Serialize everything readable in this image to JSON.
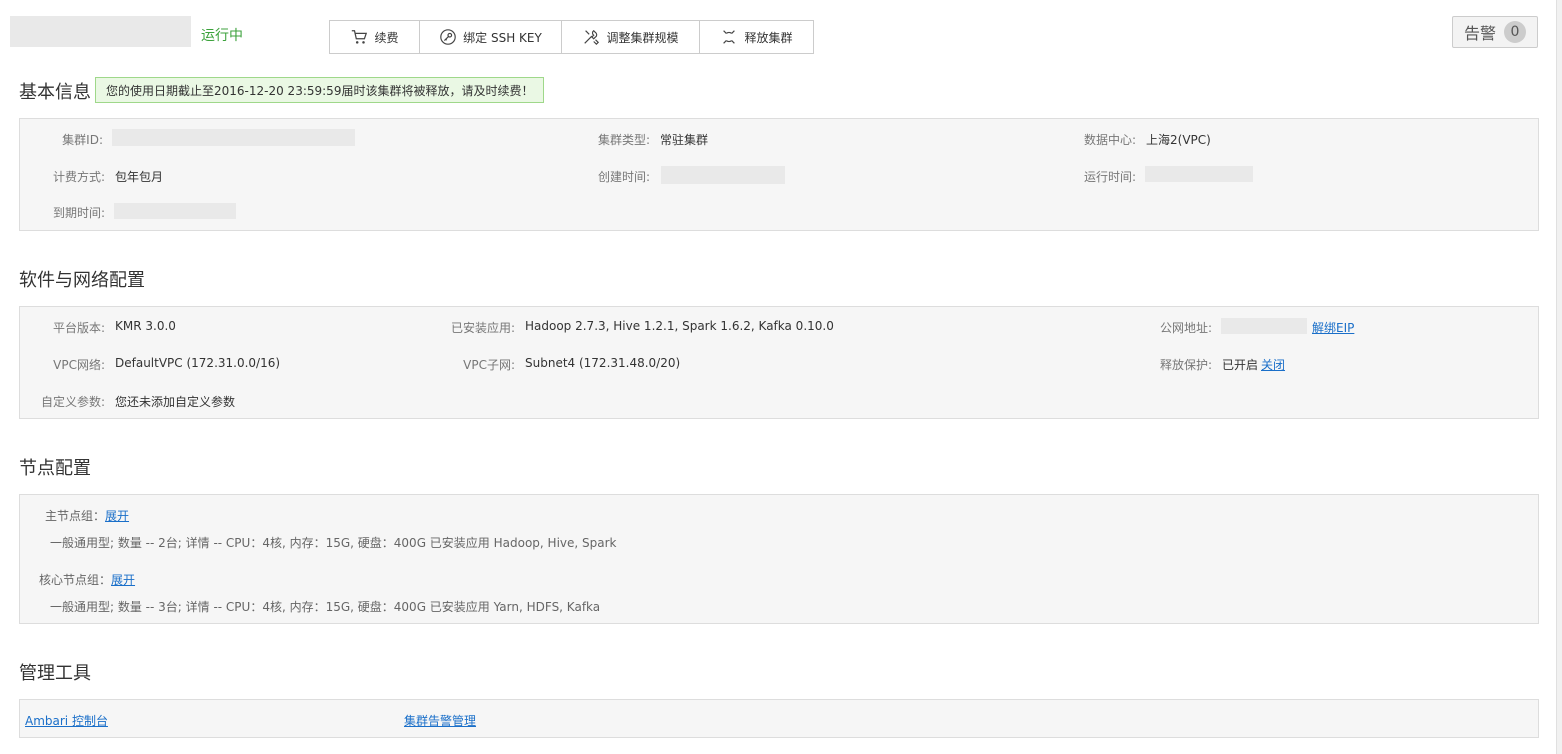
{
  "header": {
    "status": "运行中",
    "toolbar": [
      {
        "label": "续费",
        "icon": "cart-icon"
      },
      {
        "label": "绑定 SSH KEY",
        "icon": "key-icon"
      },
      {
        "label": "调整集群规模",
        "icon": "tools-icon"
      },
      {
        "label": "释放集群",
        "icon": "release-icon"
      }
    ],
    "alarm": {
      "label": "告警",
      "count": "0"
    }
  },
  "basic": {
    "title": "基本信息",
    "notice": "您的使用日期截止至2016-12-20 23:59:59届时该集群将被释放，请及时续费！",
    "cluster_id_label": "集群ID:",
    "cluster_type_label": "集群类型:",
    "cluster_type": "常驻集群",
    "datacenter_label": "数据中心:",
    "datacenter": "上海2(VPC)",
    "billing_label": "计费方式:",
    "billing": "包年包月",
    "created_label": "创建时间:",
    "runtime_label": "运行时间:",
    "expire_label": "到期时间:"
  },
  "software": {
    "title": "软件与网络配置",
    "platform_label": "平台版本:",
    "platform": "KMR 3.0.0",
    "apps_label": "已安装应用:",
    "apps": "Hadoop 2.7.3, Hive 1.2.1, Spark 1.6.2, Kafka 0.10.0",
    "public_ip_label": "公网地址:",
    "unbind_eip": "解绑EIP",
    "vpc_label": "VPC网络:",
    "vpc": "DefaultVPC (172.31.0.0/16)",
    "subnet_label": "VPC子网:",
    "subnet": "Subnet4 (172.31.48.0/20)",
    "protect_label": "释放保护:",
    "protect": "已开启",
    "protect_close": "关闭",
    "custom_label": "自定义参数:",
    "custom": "您还未添加自定义参数"
  },
  "nodes": {
    "title": "节点配置",
    "master_label": "主节点组：",
    "master_expand": "展开",
    "master_desc": "一般通用型; 数量 -- 2台; 详情 -- CPU：4核, 内存：15G, 硬盘：400G 已安装应用 Hadoop, Hive, Spark",
    "core_label": "核心节点组：",
    "core_expand": "展开",
    "core_desc": "一般通用型; 数量 -- 3台; 详情 -- CPU：4核, 内存：15G, 硬盘：400G 已安装应用 Yarn, HDFS, Kafka"
  },
  "tools": {
    "title": "管理工具",
    "ambari": "Ambari 控制台",
    "alarm_mgmt": "集群告警管理"
  }
}
